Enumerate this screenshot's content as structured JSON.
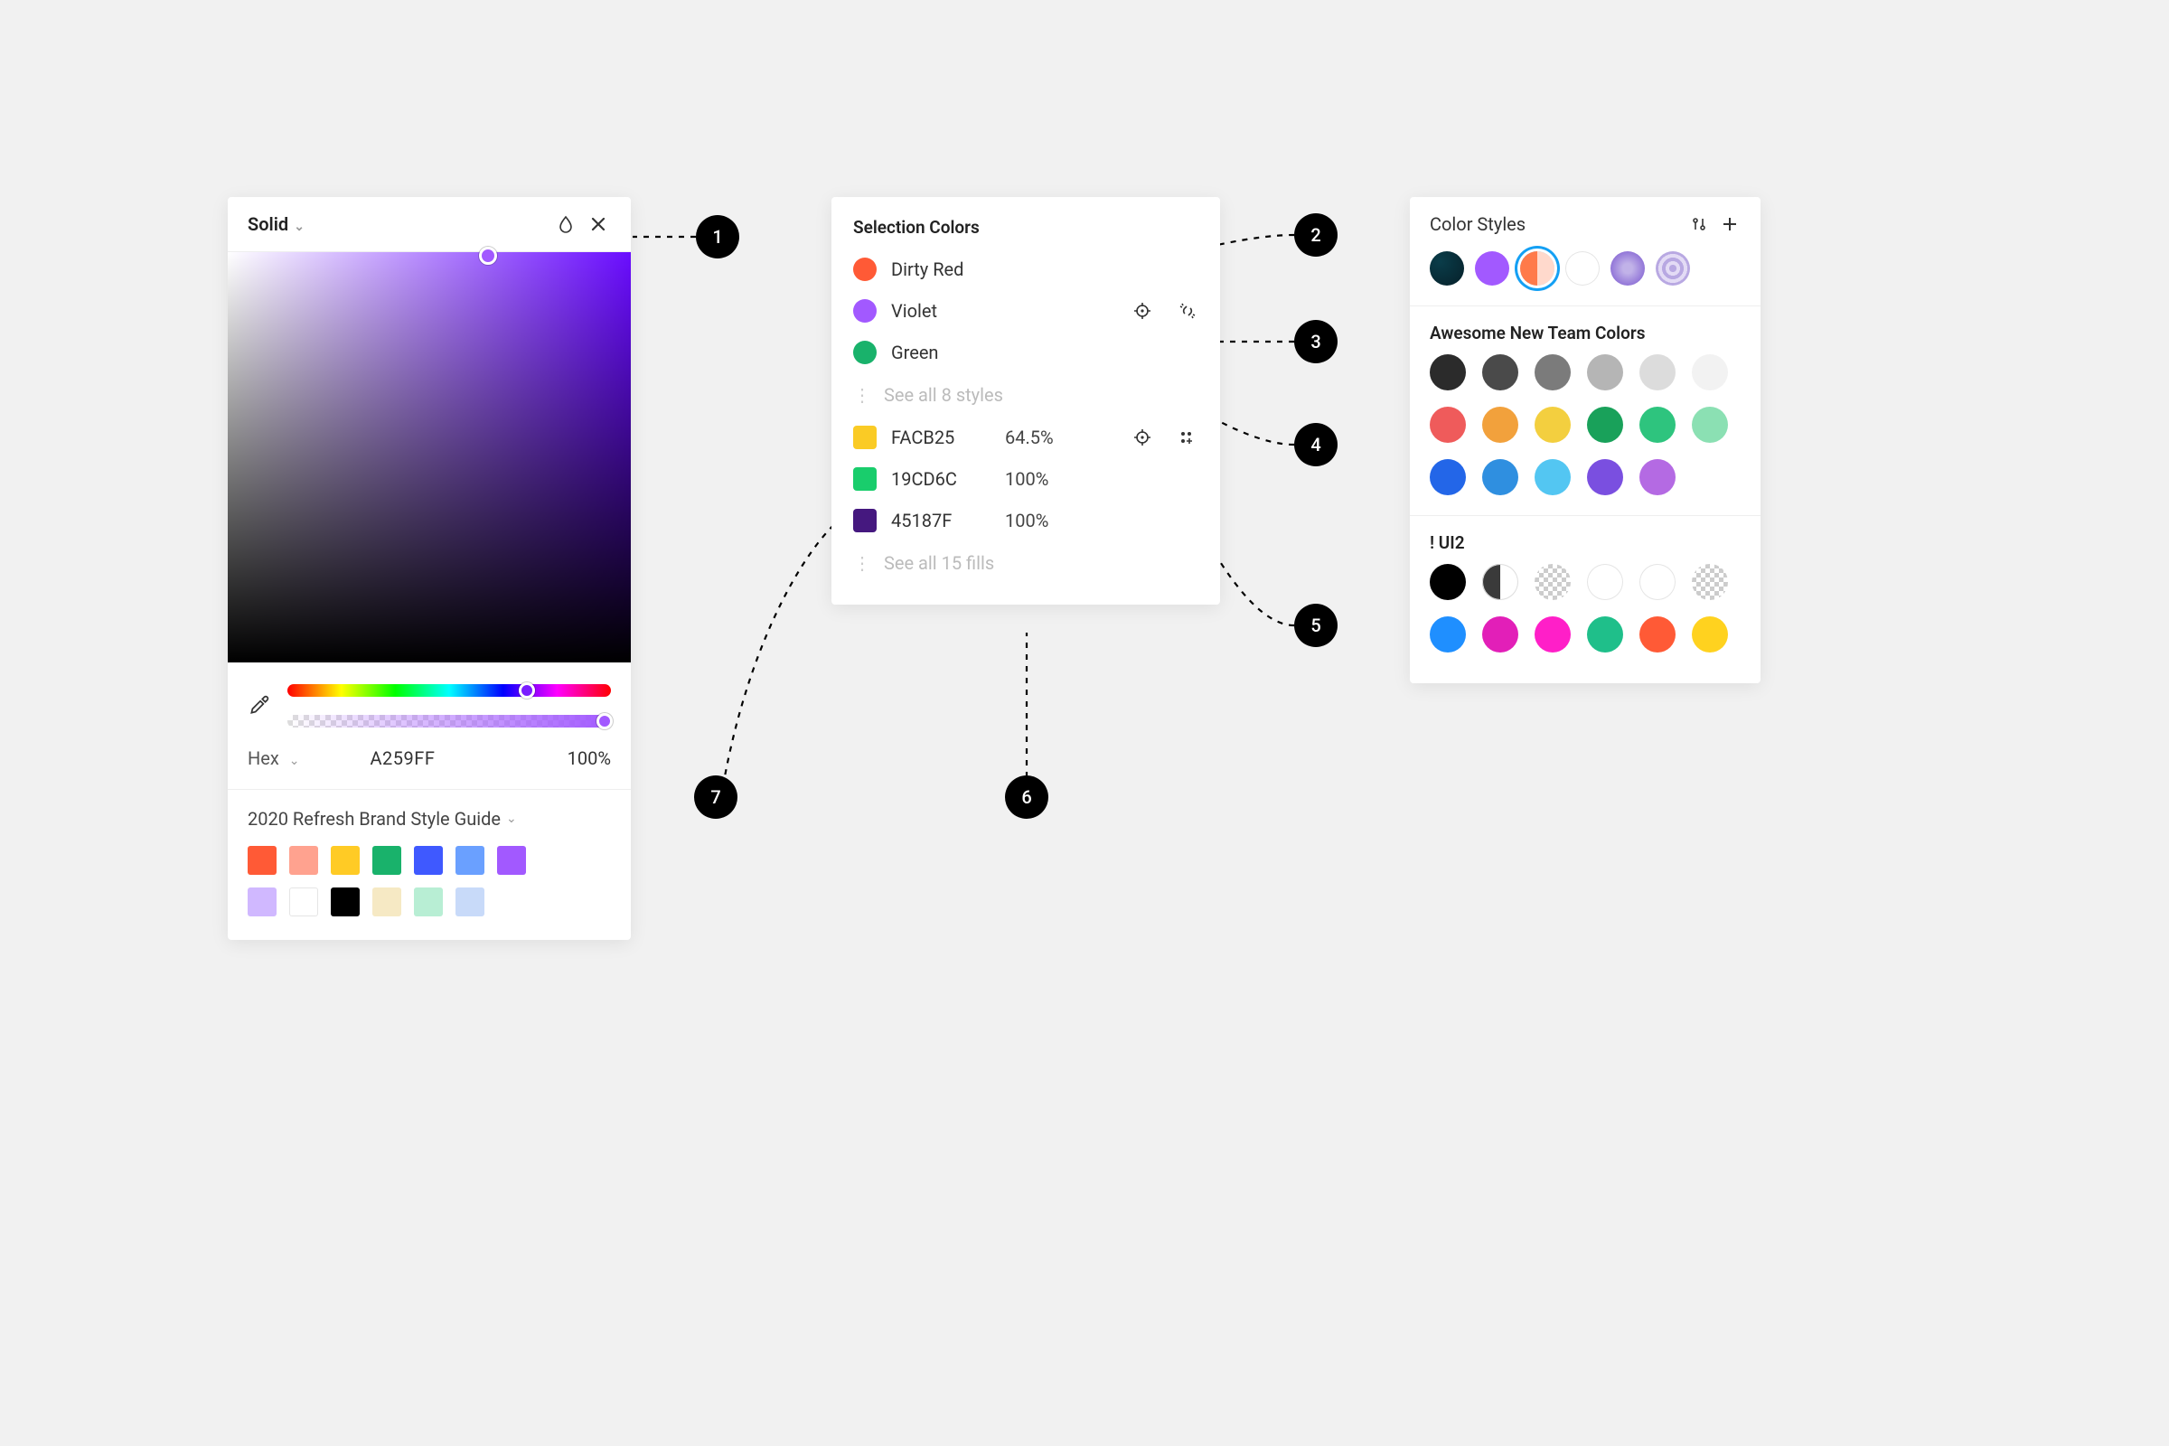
{
  "picker": {
    "mode_label": "Solid",
    "hex_label": "Hex",
    "hex_value": "A259FF",
    "opacity": "100%",
    "document_section": "2020 Refresh Brand Style Guide",
    "doc_swatches": [
      "#ff5a36",
      "#ffa28f",
      "#ffcb25",
      "#19b26b",
      "#3f59ff",
      "#6aa0ff",
      "#a259ff",
      "#d0b8ff",
      "#ffffff",
      "#000000",
      "#f6e9c4",
      "#b8eed4",
      "#c8daf9"
    ]
  },
  "selection": {
    "title": "Selection Colors",
    "styles": [
      {
        "name": "Dirty Red",
        "color": "#ff5a36"
      },
      {
        "name": "Violet",
        "color": "#a259ff"
      },
      {
        "name": "Green",
        "color": "#19b26b"
      }
    ],
    "see_styles": "See all 8 styles",
    "fills": [
      {
        "hex": "FACB25",
        "opacity": "64.5%",
        "color": "#facb25"
      },
      {
        "hex": "19CD6C",
        "opacity": "100%",
        "color": "#19cd6c"
      },
      {
        "hex": "45187F",
        "opacity": "100%",
        "color": "#45187f"
      }
    ],
    "see_fills": "See all 15 fills"
  },
  "styles_panel": {
    "title": "Color Styles",
    "group1_title": "Awesome New Team Colors",
    "group1": [
      "#2b2b2b",
      "#4a4a4a",
      "#7b7b7b",
      "#b5b5b5",
      "#dcdcdc",
      "#f2f2f2",
      "#ef5b5b",
      "#f2a13c",
      "#f3cf3f",
      "#19a15a",
      "#2ec47e",
      "#8be0b3",
      "#2366e8",
      "#2f8fe0",
      "#53c6f2",
      "#7a4fe0",
      "#b46ae3"
    ],
    "group2_title": "! UI2",
    "group2_simple": [
      "#000000"
    ],
    "group2_after": [
      "#1f8fff",
      "#e21fb8",
      "#ff1fc8",
      "#1fbf8a",
      "#ff5a36",
      "#ffd21f"
    ]
  },
  "callouts": [
    "1",
    "2",
    "3",
    "4",
    "5",
    "6",
    "7"
  ]
}
